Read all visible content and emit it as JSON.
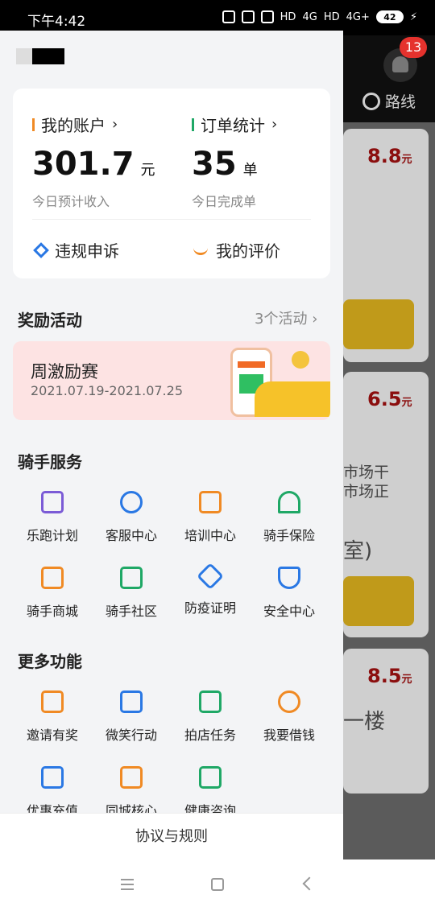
{
  "status_bar": {
    "time": "下午4:42",
    "network_labels": [
      "HD",
      "4G",
      "HD",
      "4G+"
    ],
    "battery": "42"
  },
  "background": {
    "notification_badge": "13",
    "route_label": "路线",
    "prices": [
      {
        "value": "8.8",
        "unit": "元"
      },
      {
        "value": "6.5",
        "unit": "元"
      },
      {
        "value": "8.5",
        "unit": "元"
      }
    ],
    "partial_texts": [
      "市场干",
      "市场正",
      "室)",
      "一楼"
    ]
  },
  "account": {
    "my_account": "我的账户",
    "income_value": "301.7",
    "income_unit": "元",
    "income_label": "今日预计收入",
    "orders_title": "订单统计",
    "orders_value": "35",
    "orders_unit": "单",
    "orders_label": "今日完成单",
    "appeal_label": "违规申诉",
    "review_label": "我的评价"
  },
  "rewards": {
    "title": "奖励活动",
    "count": "3个活动",
    "promo_title": "周激励赛",
    "promo_date": "2021.07.19-2021.07.25"
  },
  "rider_services": {
    "title": "骑手服务",
    "items": [
      {
        "label": "乐跑计划",
        "icon": "run-plan-icon",
        "color": "#7b5bd6"
      },
      {
        "label": "客服中心",
        "icon": "headset-icon",
        "color": "#2a78e4"
      },
      {
        "label": "培训中心",
        "icon": "book-icon",
        "color": "#f08a24"
      },
      {
        "label": "骑手保险",
        "icon": "umbrella-icon",
        "color": "#1fa866"
      },
      {
        "label": "骑手商城",
        "icon": "shirt-icon",
        "color": "#f08a24"
      },
      {
        "label": "骑手社区",
        "icon": "home-icon",
        "color": "#1fa866"
      },
      {
        "label": "防疫证明",
        "icon": "medical-icon",
        "color": "#2a78e4"
      },
      {
        "label": "安全中心",
        "icon": "shield-icon",
        "color": "#2a78e4"
      }
    ]
  },
  "more_features": {
    "title": "更多功能",
    "items": [
      {
        "label": "邀请有奖",
        "icon": "gift-icon",
        "color": "#f08a24"
      },
      {
        "label": "微笑行动",
        "icon": "smile-icon",
        "color": "#2a78e4"
      },
      {
        "label": "拍店任务",
        "icon": "camera-icon",
        "color": "#1fa866"
      },
      {
        "label": "我要借钱",
        "icon": "hand-coin-icon",
        "color": "#f08a24"
      },
      {
        "label": "优惠充值",
        "icon": "yen-card-icon",
        "color": "#2a78e4"
      },
      {
        "label": "同城核心",
        "icon": "city-icon",
        "color": "#f08a24"
      },
      {
        "label": "健康咨询",
        "icon": "monitor-plus-icon",
        "color": "#1fa866"
      }
    ]
  },
  "footer": {
    "label": "协议与规则"
  }
}
